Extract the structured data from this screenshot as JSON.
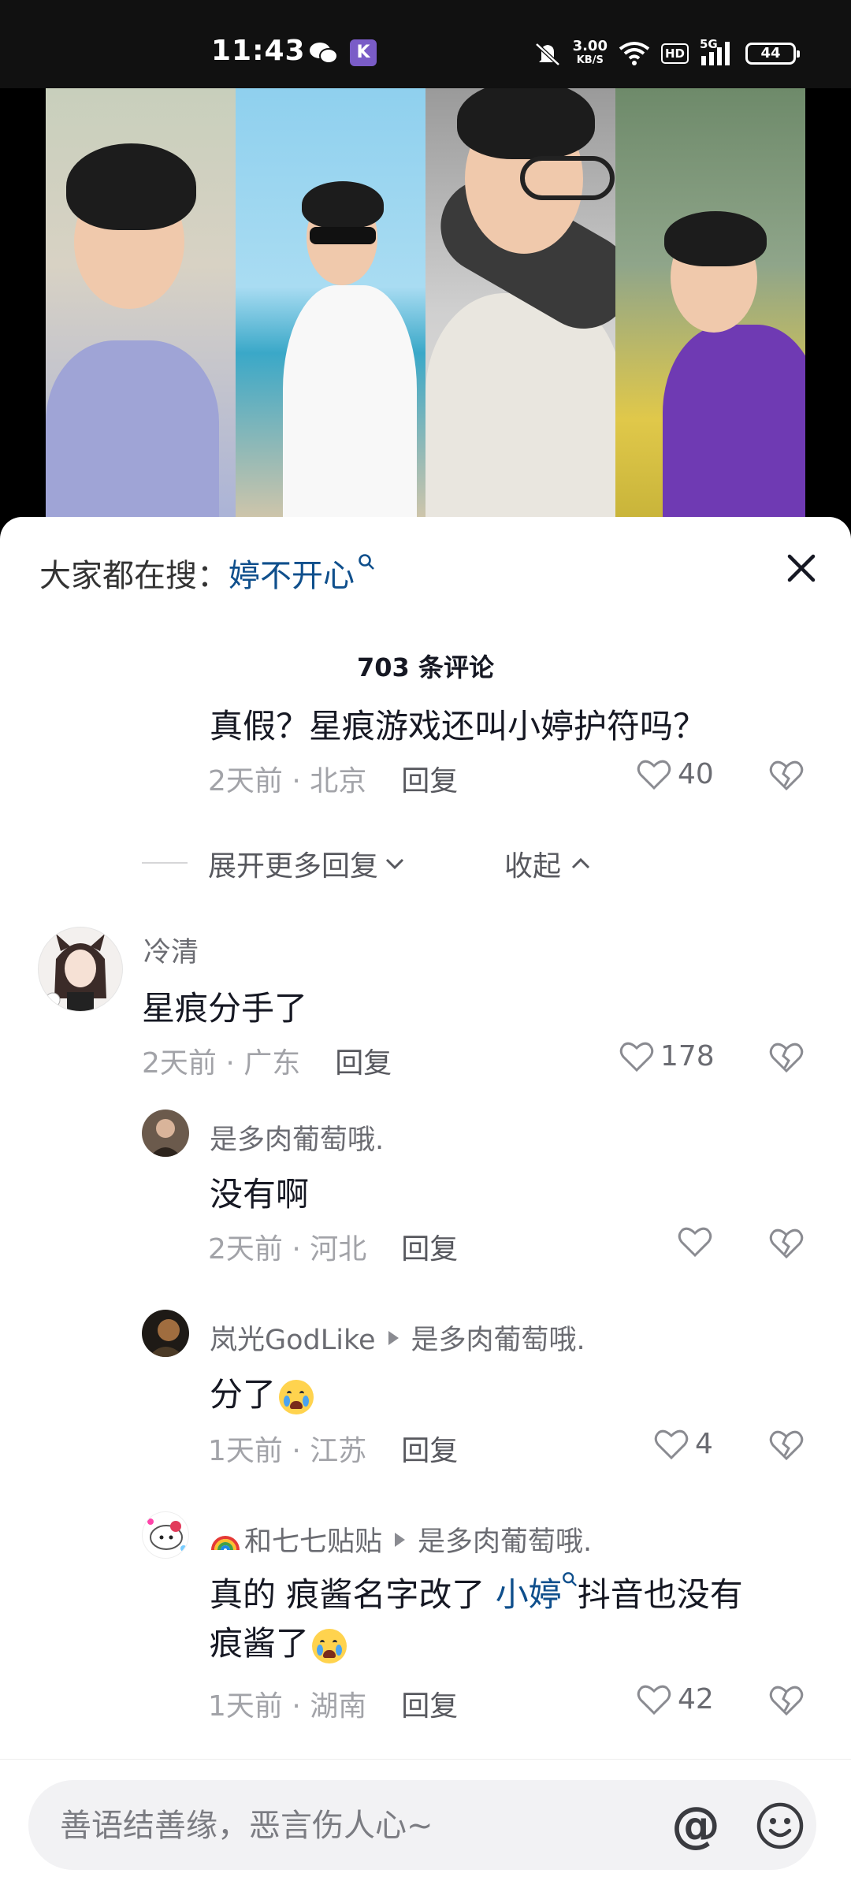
{
  "status_bar": {
    "time": "11:43",
    "net_speed_value": "3.00",
    "net_speed_unit": "KB/S",
    "hd_label": "HD",
    "signal_label": "5G",
    "battery": "44"
  },
  "sheet": {
    "hot_search_label": "大家都在搜：",
    "hot_search_keyword": "婷不开心",
    "comment_count": "703 条评论"
  },
  "comments": [
    {
      "text": "真假？星痕游戏还叫小婷护符吗？",
      "meta": "2天前 · 北京",
      "reply_label": "回复",
      "likes": "40"
    },
    {
      "author": "冷清",
      "text": "星痕分手了",
      "meta": "2天前 · 广东",
      "reply_label": "回复",
      "likes": "178"
    },
    {
      "author": "是多肉葡萄哦.",
      "text": "没有啊",
      "meta": "2天前 · 河北",
      "reply_label": "回复",
      "likes": ""
    },
    {
      "author": "岚光GodLike",
      "reply_to": "是多肉葡萄哦.",
      "text": "分了",
      "meta": "1天前 · 江苏",
      "reply_label": "回复",
      "likes": "4"
    },
    {
      "author": "和七七贴贴",
      "reply_to": "是多肉葡萄哦.",
      "text_part1": "真的 痕酱名字改了 ",
      "text_link": "小婷",
      "text_part2": "抖音也没有",
      "text_line2": "痕酱了",
      "meta": "1天前 · 湖南",
      "reply_label": "回复",
      "likes": "42"
    }
  ],
  "expand": {
    "more_label": "展开更多回复",
    "collapse_label": "收起"
  },
  "input": {
    "placeholder": "善语结善缘，恶言伤人心~",
    "at_symbol": "@"
  },
  "colors": {
    "link_blue": "#0f4f8c",
    "meta_gray": "#a2a3a8",
    "text_dark": "#161823"
  }
}
